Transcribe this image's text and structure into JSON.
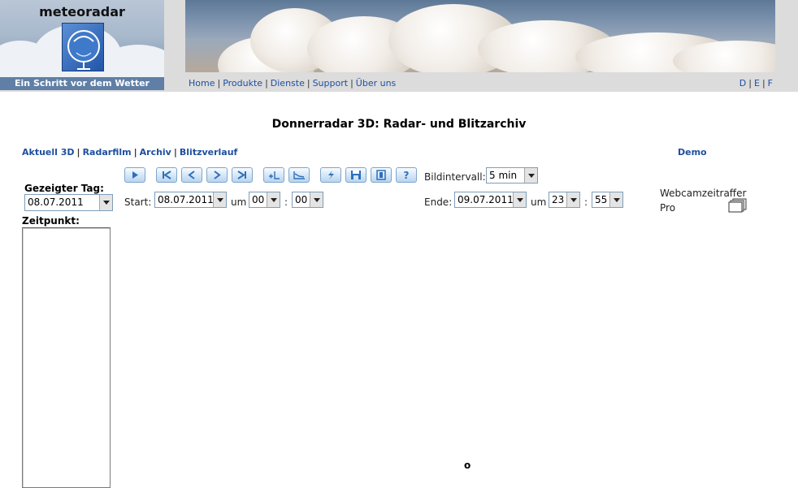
{
  "header": {
    "logo_title": "meteoradar",
    "logo_tagline": "Ein Schritt vor dem Wetter",
    "nav": [
      "Home",
      "Produkte",
      "Dienste",
      "Support",
      "Über uns"
    ],
    "lang": [
      "D",
      "E",
      "F"
    ]
  },
  "page": {
    "title": "Donnerradar 3D: Radar- und Blitzarchiv",
    "subnav": [
      "Aktuell 3D",
      "Radarfilm",
      "Archiv",
      "Blitzverlauf"
    ],
    "demo": "Demo"
  },
  "left": {
    "day_label": "Gezeigter Tag:",
    "day_value": "08.07.2011",
    "time_label": "Zeitpunkt:"
  },
  "toolbar": {
    "icons": [
      "play-icon",
      "first-frame-icon",
      "previous-frame-icon",
      "next-frame-icon",
      "last-frame-icon",
      "zoom-plus-icon",
      "chart-icon",
      "lightning-icon",
      "save-icon",
      "film-icon",
      "help-icon"
    ],
    "interval_label": "Bildintervall:",
    "interval_value": "5 min"
  },
  "range": {
    "start_label": "Start:",
    "start_date": "08.07.2011",
    "start_um": "um",
    "start_hour": "00",
    "start_colon": ":",
    "start_min": "00",
    "end_label": "Ende:",
    "end_date": "09.07.2011",
    "end_um": "um",
    "end_hour": "23",
    "end_colon": ":",
    "end_min": "55"
  },
  "webcam": {
    "label": "Webcamzeitraffer Pro"
  },
  "center_mark": "o"
}
